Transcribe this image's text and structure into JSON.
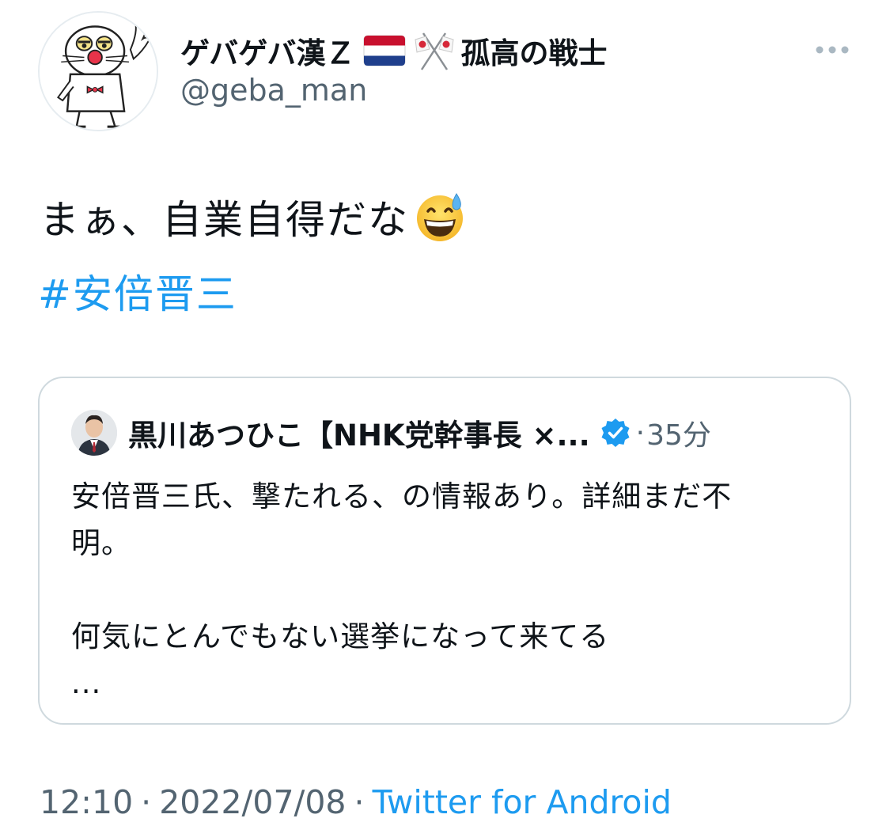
{
  "author": {
    "display_name": "ゲバゲバ漢Ｚ",
    "display_name_tail": "孤高の戦士",
    "flag_icon": "netherlands-flag-icon",
    "crossed_flags_icon": "crossed-japan-flags-icon",
    "username": "@geba_man",
    "more_icon": "more-horizontal-icon"
  },
  "tweet": {
    "text": "まぁ、自業自得だな",
    "emoji": "grinning-sweat-emoji-icon",
    "hashtag": "#安倍晋三"
  },
  "quote": {
    "name": "黒川あつひこ【NHK党幹事長 ×...",
    "verified_icon": "verified-badge-icon",
    "dot": "·",
    "time": "35分",
    "lines": [
      "安倍晋三氏、撃たれる、の情報あり。詳細まだ不",
      "明。",
      "",
      "何気にとんでもない選挙になって来てる",
      "..."
    ]
  },
  "meta": {
    "time": "12:10",
    "sep1": "·",
    "date": "2022/07/08",
    "sep2": "·",
    "source": "Twitter for Android"
  },
  "colors": {
    "link": "#1d9bf0",
    "secondary_text": "#536471",
    "border": "#cfd9de"
  }
}
